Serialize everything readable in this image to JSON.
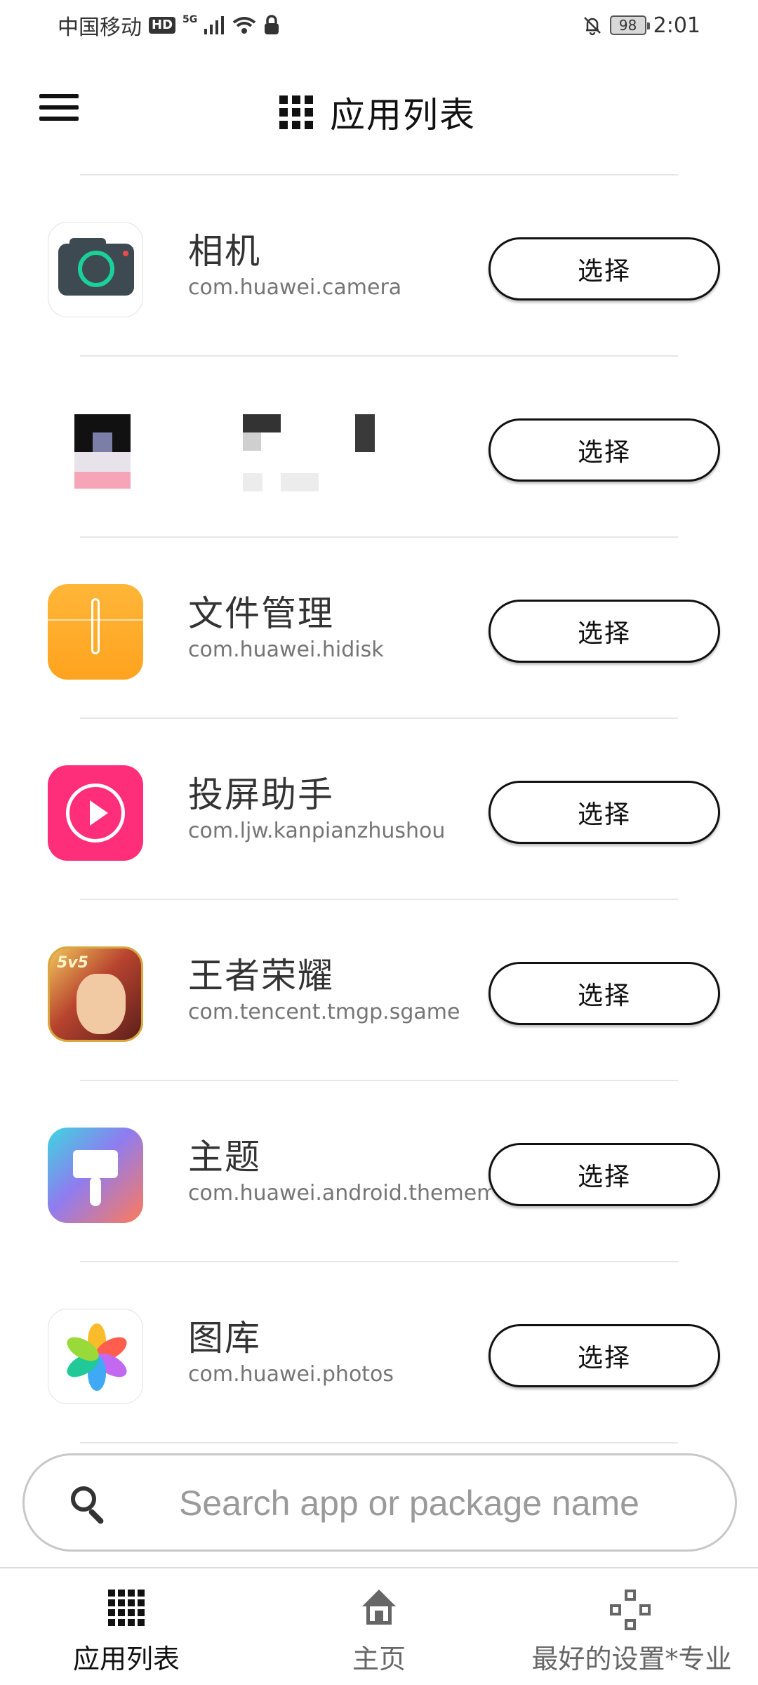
{
  "status_bar": {
    "carrier": "中国移动",
    "hd": "HD",
    "network": "5G",
    "battery": "98",
    "time": "2:01"
  },
  "header": {
    "title": "应用列表",
    "menu_icon": "hamburger-menu-icon",
    "title_icon": "app-grid-icon"
  },
  "apps": [
    {
      "name": "相机",
      "package": "com.huawei.camera",
      "button": "选择",
      "icon": "camera-app-icon"
    },
    {
      "name": "",
      "package": "",
      "button": "选择",
      "icon": "redacted-app-icon"
    },
    {
      "name": "文件管理",
      "package": "com.huawei.hidisk",
      "button": "选择",
      "icon": "files-app-icon"
    },
    {
      "name": "投屏助手",
      "package": "com.ljw.kanpianzhushou",
      "button": "选择",
      "icon": "screencast-app-icon"
    },
    {
      "name": "王者荣耀",
      "package": "com.tencent.tmgp.sgame",
      "button": "选择",
      "icon": "honor-of-kings-app-icon"
    },
    {
      "name": "主题",
      "package": "com.huawei.android.thememe",
      "button": "选择",
      "icon": "themes-app-icon"
    },
    {
      "name": "图库",
      "package": "com.huawei.photos",
      "button": "选择",
      "icon": "gallery-app-icon"
    }
  ],
  "game_icon_text": "5v5",
  "search": {
    "placeholder": "Search app or package name",
    "value": ""
  },
  "bottom_nav": {
    "items": [
      {
        "label": "应用列表",
        "icon": "app-grid-icon",
        "active": true
      },
      {
        "label": "主页",
        "icon": "home-icon",
        "active": false
      },
      {
        "label": "最好的设置*专业",
        "icon": "gamepad-icon",
        "active": false
      }
    ]
  },
  "colors": {
    "accent": "#111111",
    "divider": "#e6e6e6",
    "package_text": "#757575",
    "inactive_nav": "#666666"
  }
}
